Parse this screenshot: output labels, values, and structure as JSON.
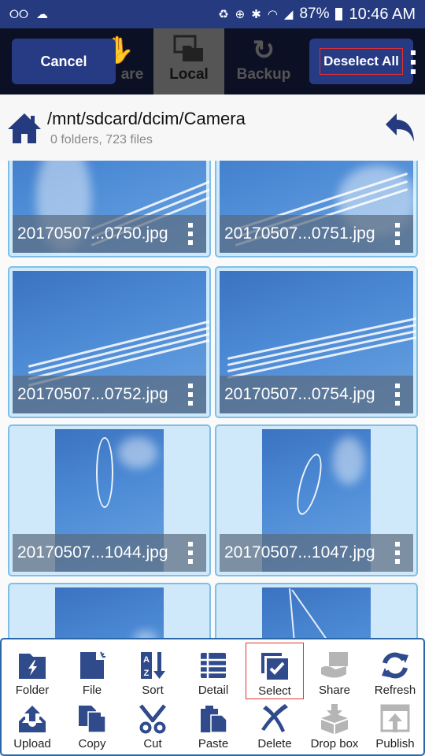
{
  "status_bar": {
    "left_icons": [
      "voicemail-icon",
      "cast-icon"
    ],
    "right_icons": [
      "battery-saver-icon",
      "data-saver-icon",
      "bluetooth-icon",
      "wifi-icon",
      "signal-icon"
    ],
    "battery": "87%",
    "time": "10:46 AM"
  },
  "top_bar": {
    "cancel_label": "Cancel",
    "deselect_all_label": "Deselect All",
    "tabs": [
      {
        "label": "Share",
        "visible_label": "are",
        "icon": "share-hand-icon"
      },
      {
        "label": "Local",
        "icon": "local-icon",
        "active": true
      },
      {
        "label": "Backup",
        "icon": "backup-sync-icon"
      }
    ]
  },
  "path_bar": {
    "path": "/mnt/sdcard/dcim/Camera",
    "summary": "0 folders, 723 files"
  },
  "files": [
    {
      "name": "20170507...0750.jpg",
      "orientation": "landscape",
      "selected": false
    },
    {
      "name": "20170507...0751.jpg",
      "orientation": "landscape",
      "selected": false
    },
    {
      "name": "20170507...0752.jpg",
      "orientation": "landscape",
      "selected": false
    },
    {
      "name": "20170507...0754.jpg",
      "orientation": "landscape",
      "selected": false
    },
    {
      "name": "20170507...1044.jpg",
      "orientation": "portrait",
      "selected": true
    },
    {
      "name": "20170507...1047.jpg",
      "orientation": "portrait",
      "selected": true
    },
    {
      "name": "",
      "orientation": "portrait",
      "selected": true
    },
    {
      "name": "",
      "orientation": "portrait",
      "selected": true
    }
  ],
  "toolbar": {
    "row1": [
      {
        "label": "Folder",
        "icon": "new-folder-icon",
        "enabled": true
      },
      {
        "label": "File",
        "icon": "new-file-icon",
        "enabled": true
      },
      {
        "label": "Sort",
        "icon": "sort-az-icon",
        "enabled": true
      },
      {
        "label": "Detail",
        "icon": "detail-list-icon",
        "enabled": true
      },
      {
        "label": "Select",
        "icon": "select-check-icon",
        "enabled": true,
        "highlighted": true
      },
      {
        "label": "Share",
        "icon": "share-icon",
        "enabled": false
      },
      {
        "label": "Refresh",
        "icon": "refresh-icon",
        "enabled": true
      }
    ],
    "row2": [
      {
        "label": "Upload",
        "icon": "upload-icon",
        "enabled": true
      },
      {
        "label": "Copy",
        "icon": "copy-icon",
        "enabled": true
      },
      {
        "label": "Cut",
        "icon": "scissors-icon",
        "enabled": true
      },
      {
        "label": "Paste",
        "icon": "paste-icon",
        "enabled": true
      },
      {
        "label": "Delete",
        "icon": "delete-x-icon",
        "enabled": true
      },
      {
        "label": "Drop box",
        "icon": "dropbox-icon",
        "enabled": false
      },
      {
        "label": "Publish",
        "icon": "publish-icon",
        "enabled": false
      }
    ]
  },
  "colors": {
    "brand": "#253A7F",
    "icon": "#2F4B8C",
    "disabled_icon": "#B5B5B5",
    "selected_tile": "#CFE9FB",
    "highlight_outline": "#D33333"
  }
}
